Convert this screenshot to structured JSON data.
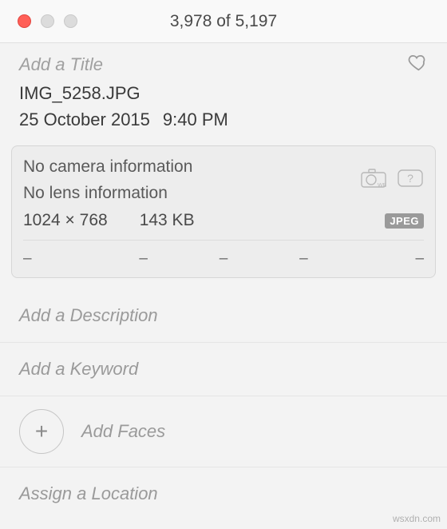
{
  "window": {
    "counter": "3,978 of 5,197"
  },
  "title_placeholder": "Add a Title",
  "filename": "IMG_5258.JPG",
  "date": "25 October 2015",
  "time": "9:40 PM",
  "meta": {
    "camera": "No camera information",
    "lens": "No lens information",
    "dimensions": "1024 × 768",
    "filesize": "143 KB",
    "format_badge": "JPEG",
    "dashes": [
      "–",
      "–",
      "–",
      "–",
      "–"
    ]
  },
  "placeholders": {
    "description": "Add a Description",
    "keyword": "Add a Keyword",
    "faces": "Add Faces",
    "location": "Assign a Location"
  },
  "icons": {
    "heart": "heart-icon",
    "wb": "wb-icon",
    "format": "format-icon",
    "plus": "plus-icon"
  },
  "watermark": "wsxdn.com"
}
